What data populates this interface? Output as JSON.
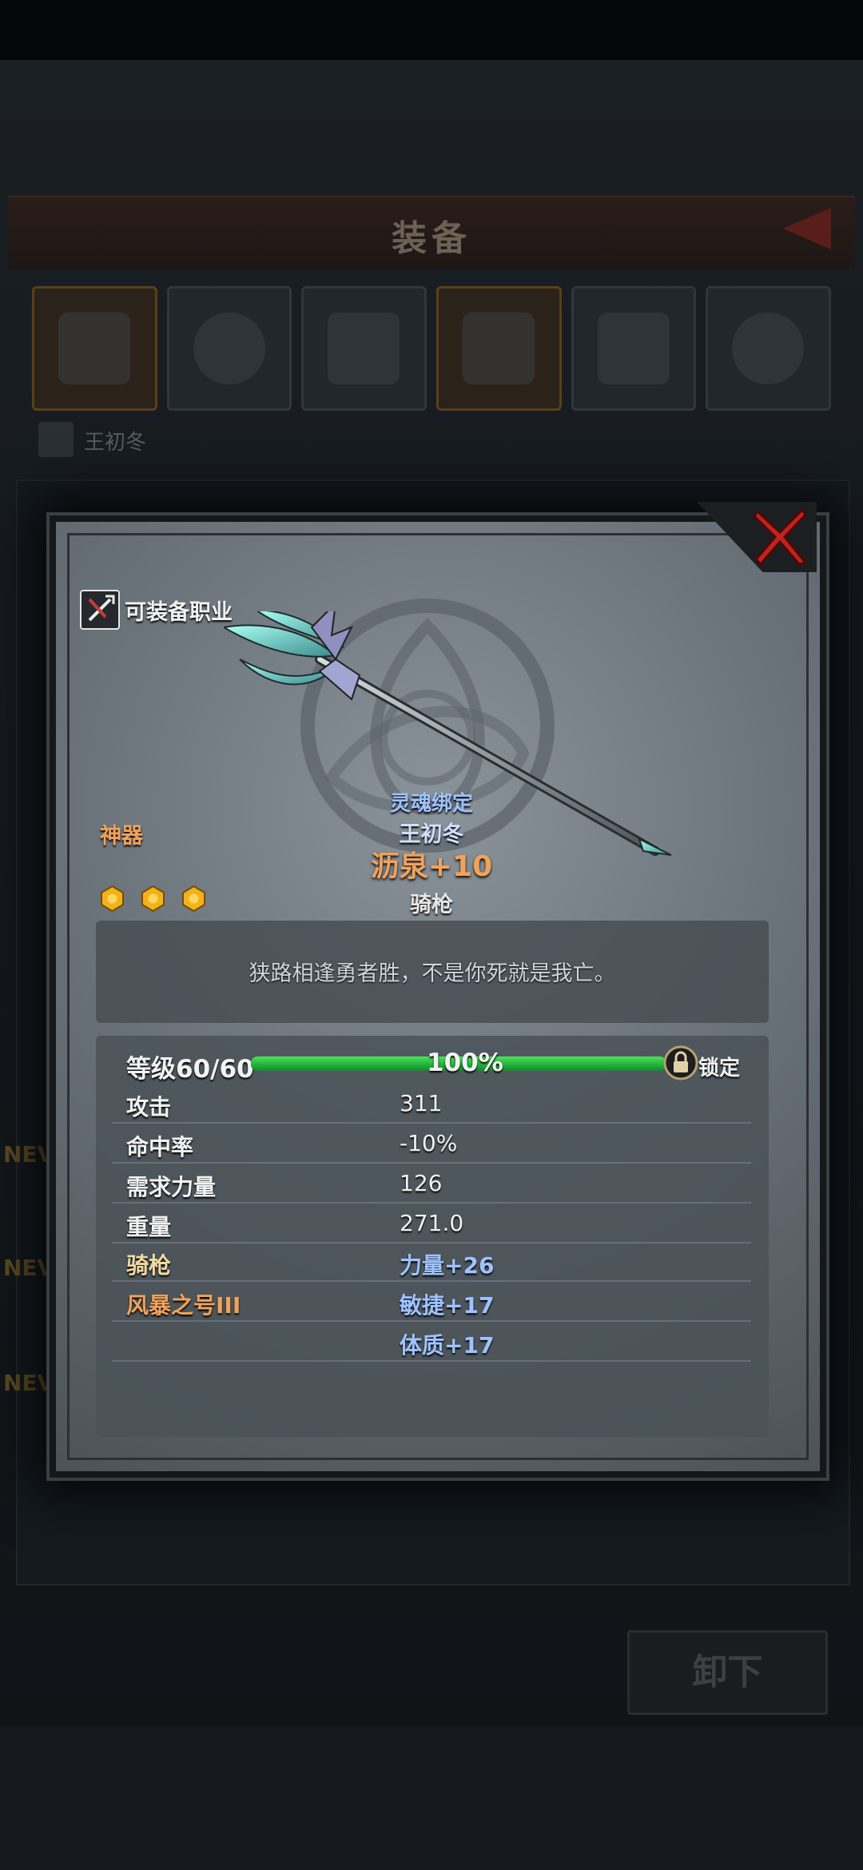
{
  "background": {
    "title": "装备",
    "owner_name": "王初冬",
    "new_badges": [
      "NEV",
      "NEV",
      "NEV"
    ],
    "unequip_label": "卸下",
    "equipment_slots": [
      "weapon",
      "shield",
      "helmet",
      "armor",
      "boots",
      "ring"
    ]
  },
  "modal": {
    "class_label": "可装备职业",
    "rarity": "神器",
    "star_count": 3,
    "soulbound": "灵魂绑定",
    "owner": "王初冬",
    "item_name": "沥泉+10",
    "item_type": "骑枪",
    "description": "狭路相逢勇者胜，不是你死就是我亡。",
    "level": {
      "label": "等级60/60",
      "percent_text": "100%",
      "progress": 1.0,
      "lock_label": "锁定"
    },
    "stats": [
      {
        "label": "攻击",
        "value": "311"
      },
      {
        "label": "命中率",
        "value": "-10%"
      },
      {
        "label": "需求力量",
        "value": "126"
      },
      {
        "label": "重量",
        "value": "271.0"
      },
      {
        "label": "骑枪",
        "value": "力量+26"
      },
      {
        "label": "风暴之号III",
        "value": "敏捷+17"
      },
      {
        "label": "",
        "value": "体质+17"
      }
    ]
  },
  "colors": {
    "orange": "#f0a25a",
    "blue_text": "#9ec3ff",
    "progress_green": "#1fb03a",
    "close_red": "#c0231e"
  }
}
